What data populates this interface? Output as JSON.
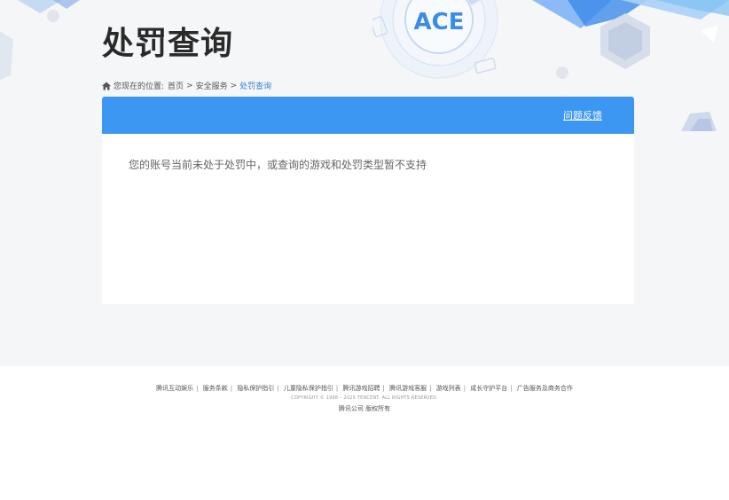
{
  "header": {
    "title": "处罚查询",
    "logo_text": "ACE"
  },
  "breadcrumb": {
    "prefix": "您现在的位置:",
    "items": [
      "首页",
      "安全服务",
      "处罚查询"
    ],
    "separator": ">"
  },
  "panel": {
    "feedback_label": "问题反馈",
    "message": "您的账号当前未处于处罚中，或查询的游戏和处罚类型暂不支持"
  },
  "footer": {
    "links": [
      "腾讯互动娱乐",
      "服务条款",
      "隐私保护指引",
      "儿童隐私保护指引",
      "腾讯游戏招聘",
      "腾讯游戏客服",
      "游戏列表",
      "成长守护平台",
      "广告服务及商务合作"
    ],
    "link_separator": "|",
    "copyright": "COPYRIGHT © 1998 – 2025 TENCENT. ALL RIGHTS RESERVED.",
    "company": "腾讯公司 版权所有"
  },
  "colors": {
    "accent": "#3c97f3",
    "page_bg": "#f5f6f8",
    "breadcrumb_current": "#3a80d8"
  }
}
